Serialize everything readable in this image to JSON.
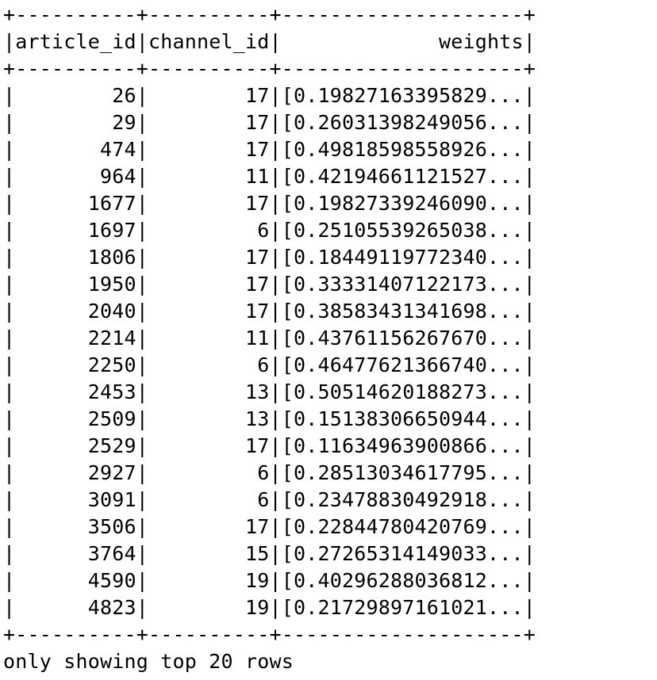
{
  "table": {
    "border_line": "+----------+----------+--------------------+",
    "columns": [
      "article_id",
      "channel_id",
      "weights"
    ],
    "rows": [
      [
        "26",
        "17",
        "[0.19827163395829..."
      ],
      [
        "29",
        "17",
        "[0.26031398249056..."
      ],
      [
        "474",
        "17",
        "[0.49818598558926..."
      ],
      [
        "964",
        "11",
        "[0.42194661121527..."
      ],
      [
        "1677",
        "17",
        "[0.19827339246090..."
      ],
      [
        "1697",
        "6",
        "[0.25105539265038..."
      ],
      [
        "1806",
        "17",
        "[0.18449119772340..."
      ],
      [
        "1950",
        "17",
        "[0.33331407122173..."
      ],
      [
        "2040",
        "17",
        "[0.38583431341698..."
      ],
      [
        "2214",
        "11",
        "[0.43761156267670..."
      ],
      [
        "2250",
        "6",
        "[0.46477621366740..."
      ],
      [
        "2453",
        "13",
        "[0.50514620188273..."
      ],
      [
        "2509",
        "13",
        "[0.15138306650944..."
      ],
      [
        "2529",
        "17",
        "[0.11634963900866..."
      ],
      [
        "2927",
        "6",
        "[0.28513034617795..."
      ],
      [
        "3091",
        "6",
        "[0.23478830492918..."
      ],
      [
        "3506",
        "17",
        "[0.22844780420769..."
      ],
      [
        "3764",
        "15",
        "[0.27265314149033..."
      ],
      [
        "4590",
        "19",
        "[0.40296288036812..."
      ],
      [
        "4823",
        "19",
        "[0.21729897161021..."
      ]
    ]
  },
  "footer": "only showing top 20 rows"
}
